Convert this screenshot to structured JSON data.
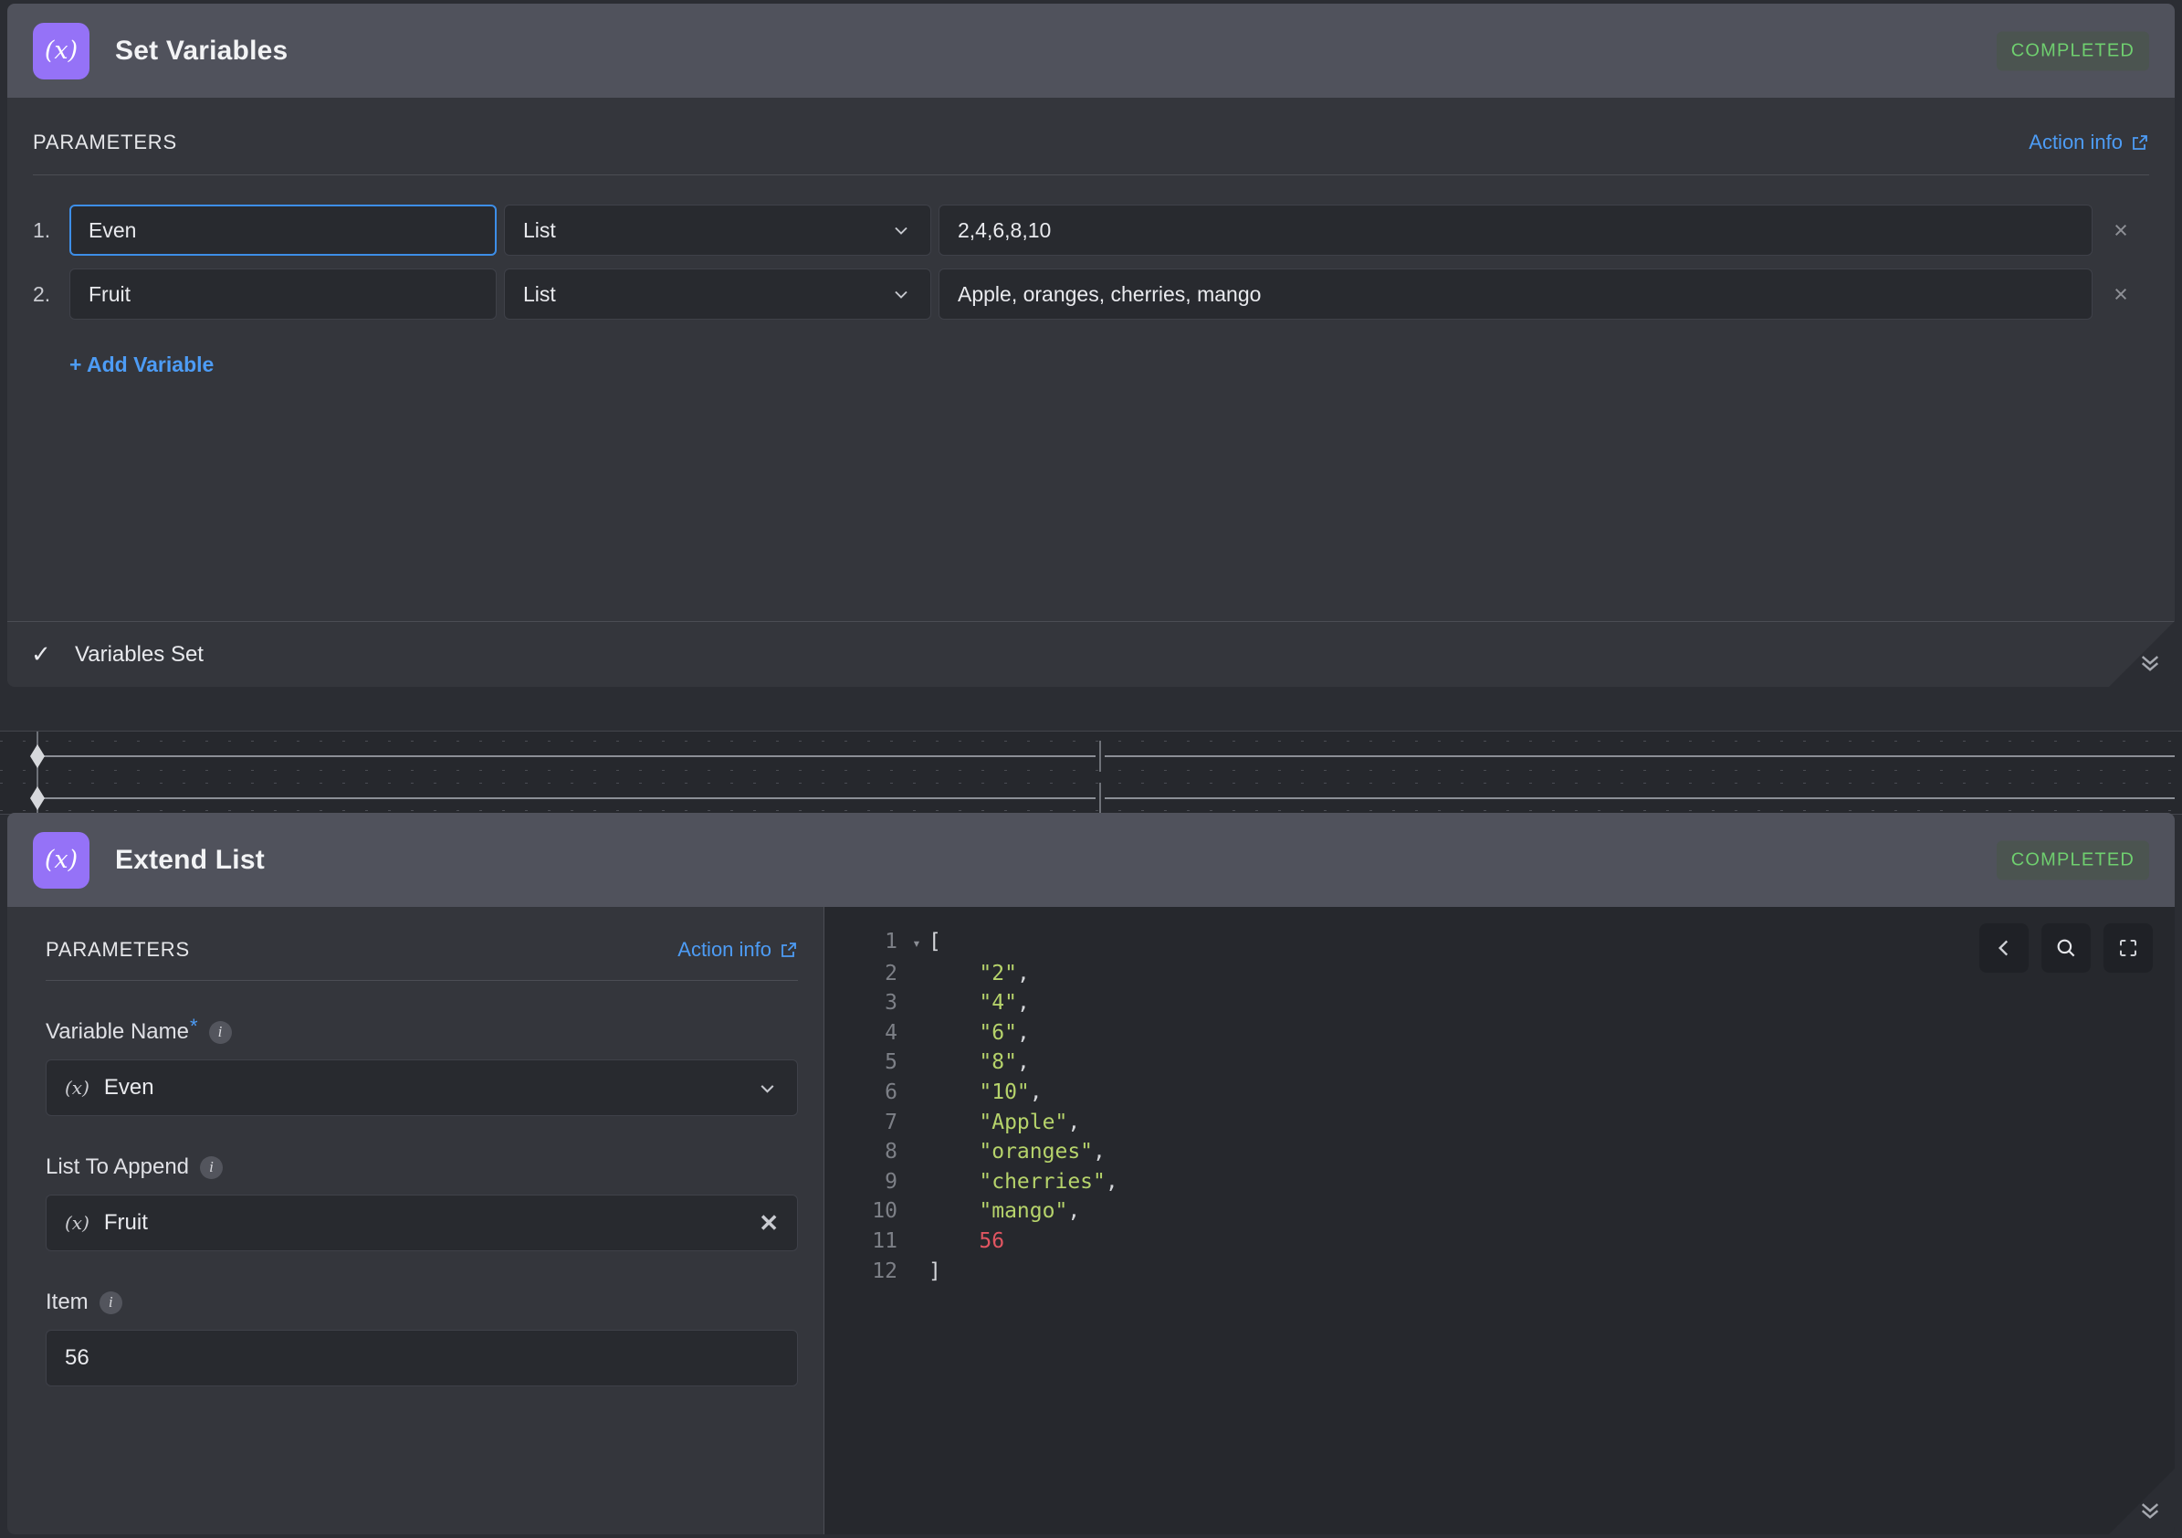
{
  "theme": {
    "page_bg": "#2b2d33",
    "panel_bg": "#34363c",
    "header_bg": "#50525c",
    "field_bg": "#282a2f",
    "accent_blue": "#4d9cf5",
    "accent_purple": "#9572f7",
    "status_green": "#6fcf6f",
    "code_string": "#b6d36b",
    "code_number": "#e05561"
  },
  "set_variables": {
    "icon": "variable-x-icon",
    "icon_glyph": "(x)",
    "title": "Set Variables",
    "status": "COMPLETED",
    "parameters_label": "PARAMETERS",
    "action_info_label": "Action info",
    "action_info_icon": "external-link-icon",
    "add_variable_label": "+ Add Variable",
    "remove_icon_glyph": "×",
    "chevron_down_icon": "chevron-down-icon",
    "rows": [
      {
        "index": "1.",
        "name": "Even",
        "type": "List",
        "value": "2,4,6,8,10",
        "focused": true
      },
      {
        "index": "2.",
        "name": "Fruit",
        "type": "List",
        "value": "Apple, oranges, cherries, mango",
        "focused": false
      }
    ],
    "footer": {
      "check_glyph": "✓",
      "label": "Variables Set",
      "collapse_icon": "chevron-double-down-icon",
      "collapse_glyph": "»"
    }
  },
  "timeline": {
    "name": "execution-timeline",
    "marker_icon": "diamond-marker-icon",
    "row_count": 2
  },
  "extend_list": {
    "icon": "variable-x-icon",
    "icon_glyph": "(x)",
    "title": "Extend List",
    "status": "COMPLETED",
    "parameters_label": "PARAMETERS",
    "action_info_label": "Action info",
    "action_info_icon": "external-link-icon",
    "fields": [
      {
        "label": "Variable Name",
        "required": true,
        "required_glyph": "*",
        "info_glyph": "i",
        "token_glyph": "(x)",
        "value": "Even",
        "control": "select",
        "control_icon": "chevron-down-icon"
      },
      {
        "label": "List To Append",
        "required": false,
        "info_glyph": "i",
        "token_glyph": "(x)",
        "value": "Fruit",
        "control": "clear",
        "control_icon": "close-icon",
        "control_glyph": "✕"
      },
      {
        "label": "Item",
        "required": false,
        "info_glyph": "i",
        "token_glyph": "",
        "value": "56",
        "control": "none"
      }
    ],
    "editor": {
      "toolbar": [
        {
          "icon": "chevron-left-icon",
          "name": "collapse-editor-button"
        },
        {
          "icon": "search-icon",
          "name": "search-button"
        },
        {
          "icon": "fullscreen-icon",
          "name": "fullscreen-button"
        }
      ],
      "fold_glyph": "▾",
      "lines": [
        {
          "n": "1",
          "fold": true,
          "indent": 0,
          "tokens": [
            {
              "t": "punc",
              "v": "["
            }
          ]
        },
        {
          "n": "2",
          "fold": false,
          "indent": 1,
          "tokens": [
            {
              "t": "str",
              "v": "\"2\""
            },
            {
              "t": "punc",
              "v": ","
            }
          ]
        },
        {
          "n": "3",
          "fold": false,
          "indent": 1,
          "tokens": [
            {
              "t": "str",
              "v": "\"4\""
            },
            {
              "t": "punc",
              "v": ","
            }
          ]
        },
        {
          "n": "4",
          "fold": false,
          "indent": 1,
          "tokens": [
            {
              "t": "str",
              "v": "\"6\""
            },
            {
              "t": "punc",
              "v": ","
            }
          ]
        },
        {
          "n": "5",
          "fold": false,
          "indent": 1,
          "tokens": [
            {
              "t": "str",
              "v": "\"8\""
            },
            {
              "t": "punc",
              "v": ","
            }
          ]
        },
        {
          "n": "6",
          "fold": false,
          "indent": 1,
          "tokens": [
            {
              "t": "str",
              "v": "\"10\""
            },
            {
              "t": "punc",
              "v": ","
            }
          ]
        },
        {
          "n": "7",
          "fold": false,
          "indent": 1,
          "tokens": [
            {
              "t": "str",
              "v": "\"Apple\""
            },
            {
              "t": "punc",
              "v": ","
            }
          ]
        },
        {
          "n": "8",
          "fold": false,
          "indent": 1,
          "tokens": [
            {
              "t": "str",
              "v": "\"oranges\""
            },
            {
              "t": "punc",
              "v": ","
            }
          ]
        },
        {
          "n": "9",
          "fold": false,
          "indent": 1,
          "tokens": [
            {
              "t": "str",
              "v": "\"cherries\""
            },
            {
              "t": "punc",
              "v": ","
            }
          ]
        },
        {
          "n": "10",
          "fold": false,
          "indent": 1,
          "tokens": [
            {
              "t": "str",
              "v": "\"mango\""
            },
            {
              "t": "punc",
              "v": ","
            }
          ]
        },
        {
          "n": "11",
          "fold": false,
          "indent": 1,
          "tokens": [
            {
              "t": "num",
              "v": "56"
            }
          ]
        },
        {
          "n": "12",
          "fold": false,
          "indent": 0,
          "tokens": [
            {
              "t": "punc",
              "v": "]"
            }
          ]
        }
      ],
      "result_array": [
        "2",
        "4",
        "6",
        "8",
        "10",
        "Apple",
        "oranges",
        "cherries",
        "mango",
        56
      ]
    },
    "footer": {
      "collapse_icon": "chevron-double-down-icon",
      "collapse_glyph": "»"
    }
  }
}
